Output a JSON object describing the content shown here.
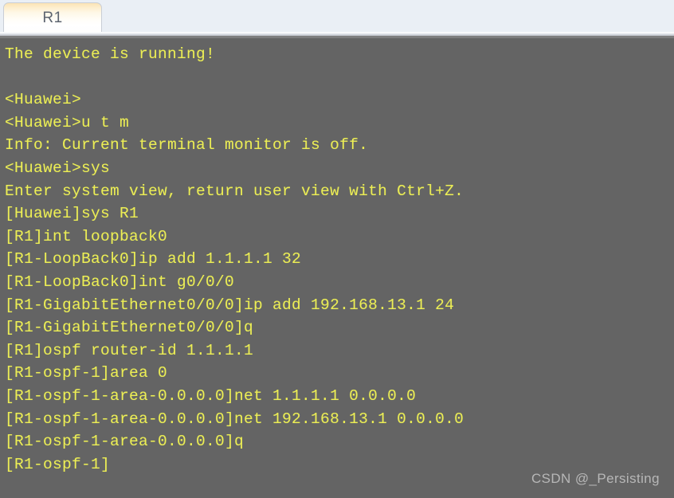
{
  "window": {
    "tabs": [
      {
        "label": "R1",
        "active": true
      }
    ]
  },
  "terminal": {
    "background_color": "#646464",
    "text_color": "#eded55",
    "lines": [
      "The device is running!",
      "",
      "<Huawei>",
      "<Huawei>u t m",
      "Info: Current terminal monitor is off.",
      "<Huawei>sys",
      "Enter system view, return user view with Ctrl+Z.",
      "[Huawei]sys R1",
      "[R1]int loopback0",
      "[R1-LoopBack0]ip add 1.1.1.1 32",
      "[R1-LoopBack0]int g0/0/0",
      "[R1-GigabitEthernet0/0/0]ip add 192.168.13.1 24",
      "[R1-GigabitEthernet0/0/0]q",
      "[R1]ospf router-id 1.1.1.1",
      "[R1-ospf-1]area 0",
      "[R1-ospf-1-area-0.0.0.0]net 1.1.1.1 0.0.0.0",
      "[R1-ospf-1-area-0.0.0.0]net 192.168.13.1 0.0.0.0",
      "[R1-ospf-1-area-0.0.0.0]q",
      "[R1-ospf-1]"
    ]
  },
  "watermark": {
    "text": "CSDN @_Persisting"
  }
}
